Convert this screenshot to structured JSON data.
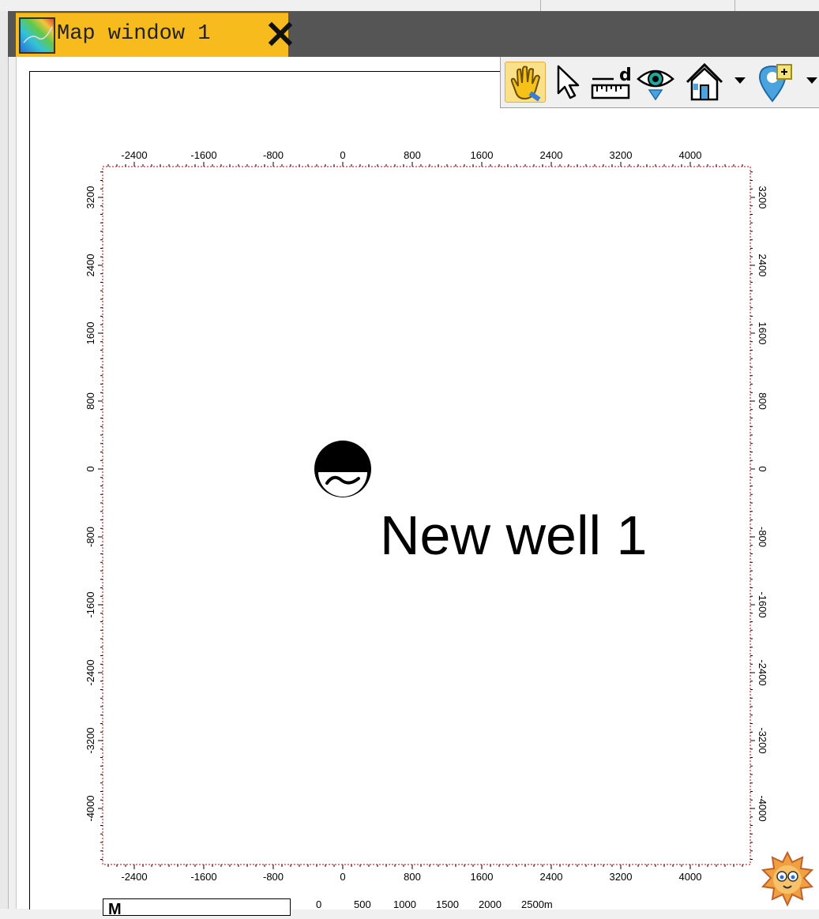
{
  "window": {
    "tab_title": "Map window 1",
    "close_label": "✕"
  },
  "toolbar": {
    "tools": [
      {
        "name": "pan",
        "icon": "hand-icon",
        "active": true
      },
      {
        "name": "select",
        "icon": "cursor-arrow-icon",
        "active": false
      },
      {
        "name": "measure",
        "icon": "ruler-measure-icon",
        "active": false
      },
      {
        "name": "view",
        "icon": "eye-view-icon",
        "active": false
      },
      {
        "name": "home",
        "icon": "home-icon",
        "active": false
      },
      {
        "name": "marker",
        "icon": "map-pin-icon",
        "active": false
      }
    ]
  },
  "map": {
    "x_ticks": [
      "-2400",
      "-1600",
      "-800",
      "0",
      "800",
      "1600",
      "2400",
      "3200",
      "4000"
    ],
    "y_ticks": [
      "3200",
      "2400",
      "1600",
      "800",
      "0",
      "-800",
      "-1600",
      "-2400",
      "-3200",
      "-4000"
    ],
    "well": {
      "label": "New well 1",
      "x": 0,
      "y": 0,
      "symbol": "water-well-symbol-icon"
    },
    "frame_color": "#cc0000"
  },
  "scale_bar": {
    "unit_label": "M",
    "labels": [
      "0",
      "500",
      "1000",
      "1500",
      "2000",
      "2500m"
    ]
  },
  "colors": {
    "tab_active": "#f7bb1e",
    "tab_bar": "#555555",
    "active_tool": "#fbe08a"
  }
}
